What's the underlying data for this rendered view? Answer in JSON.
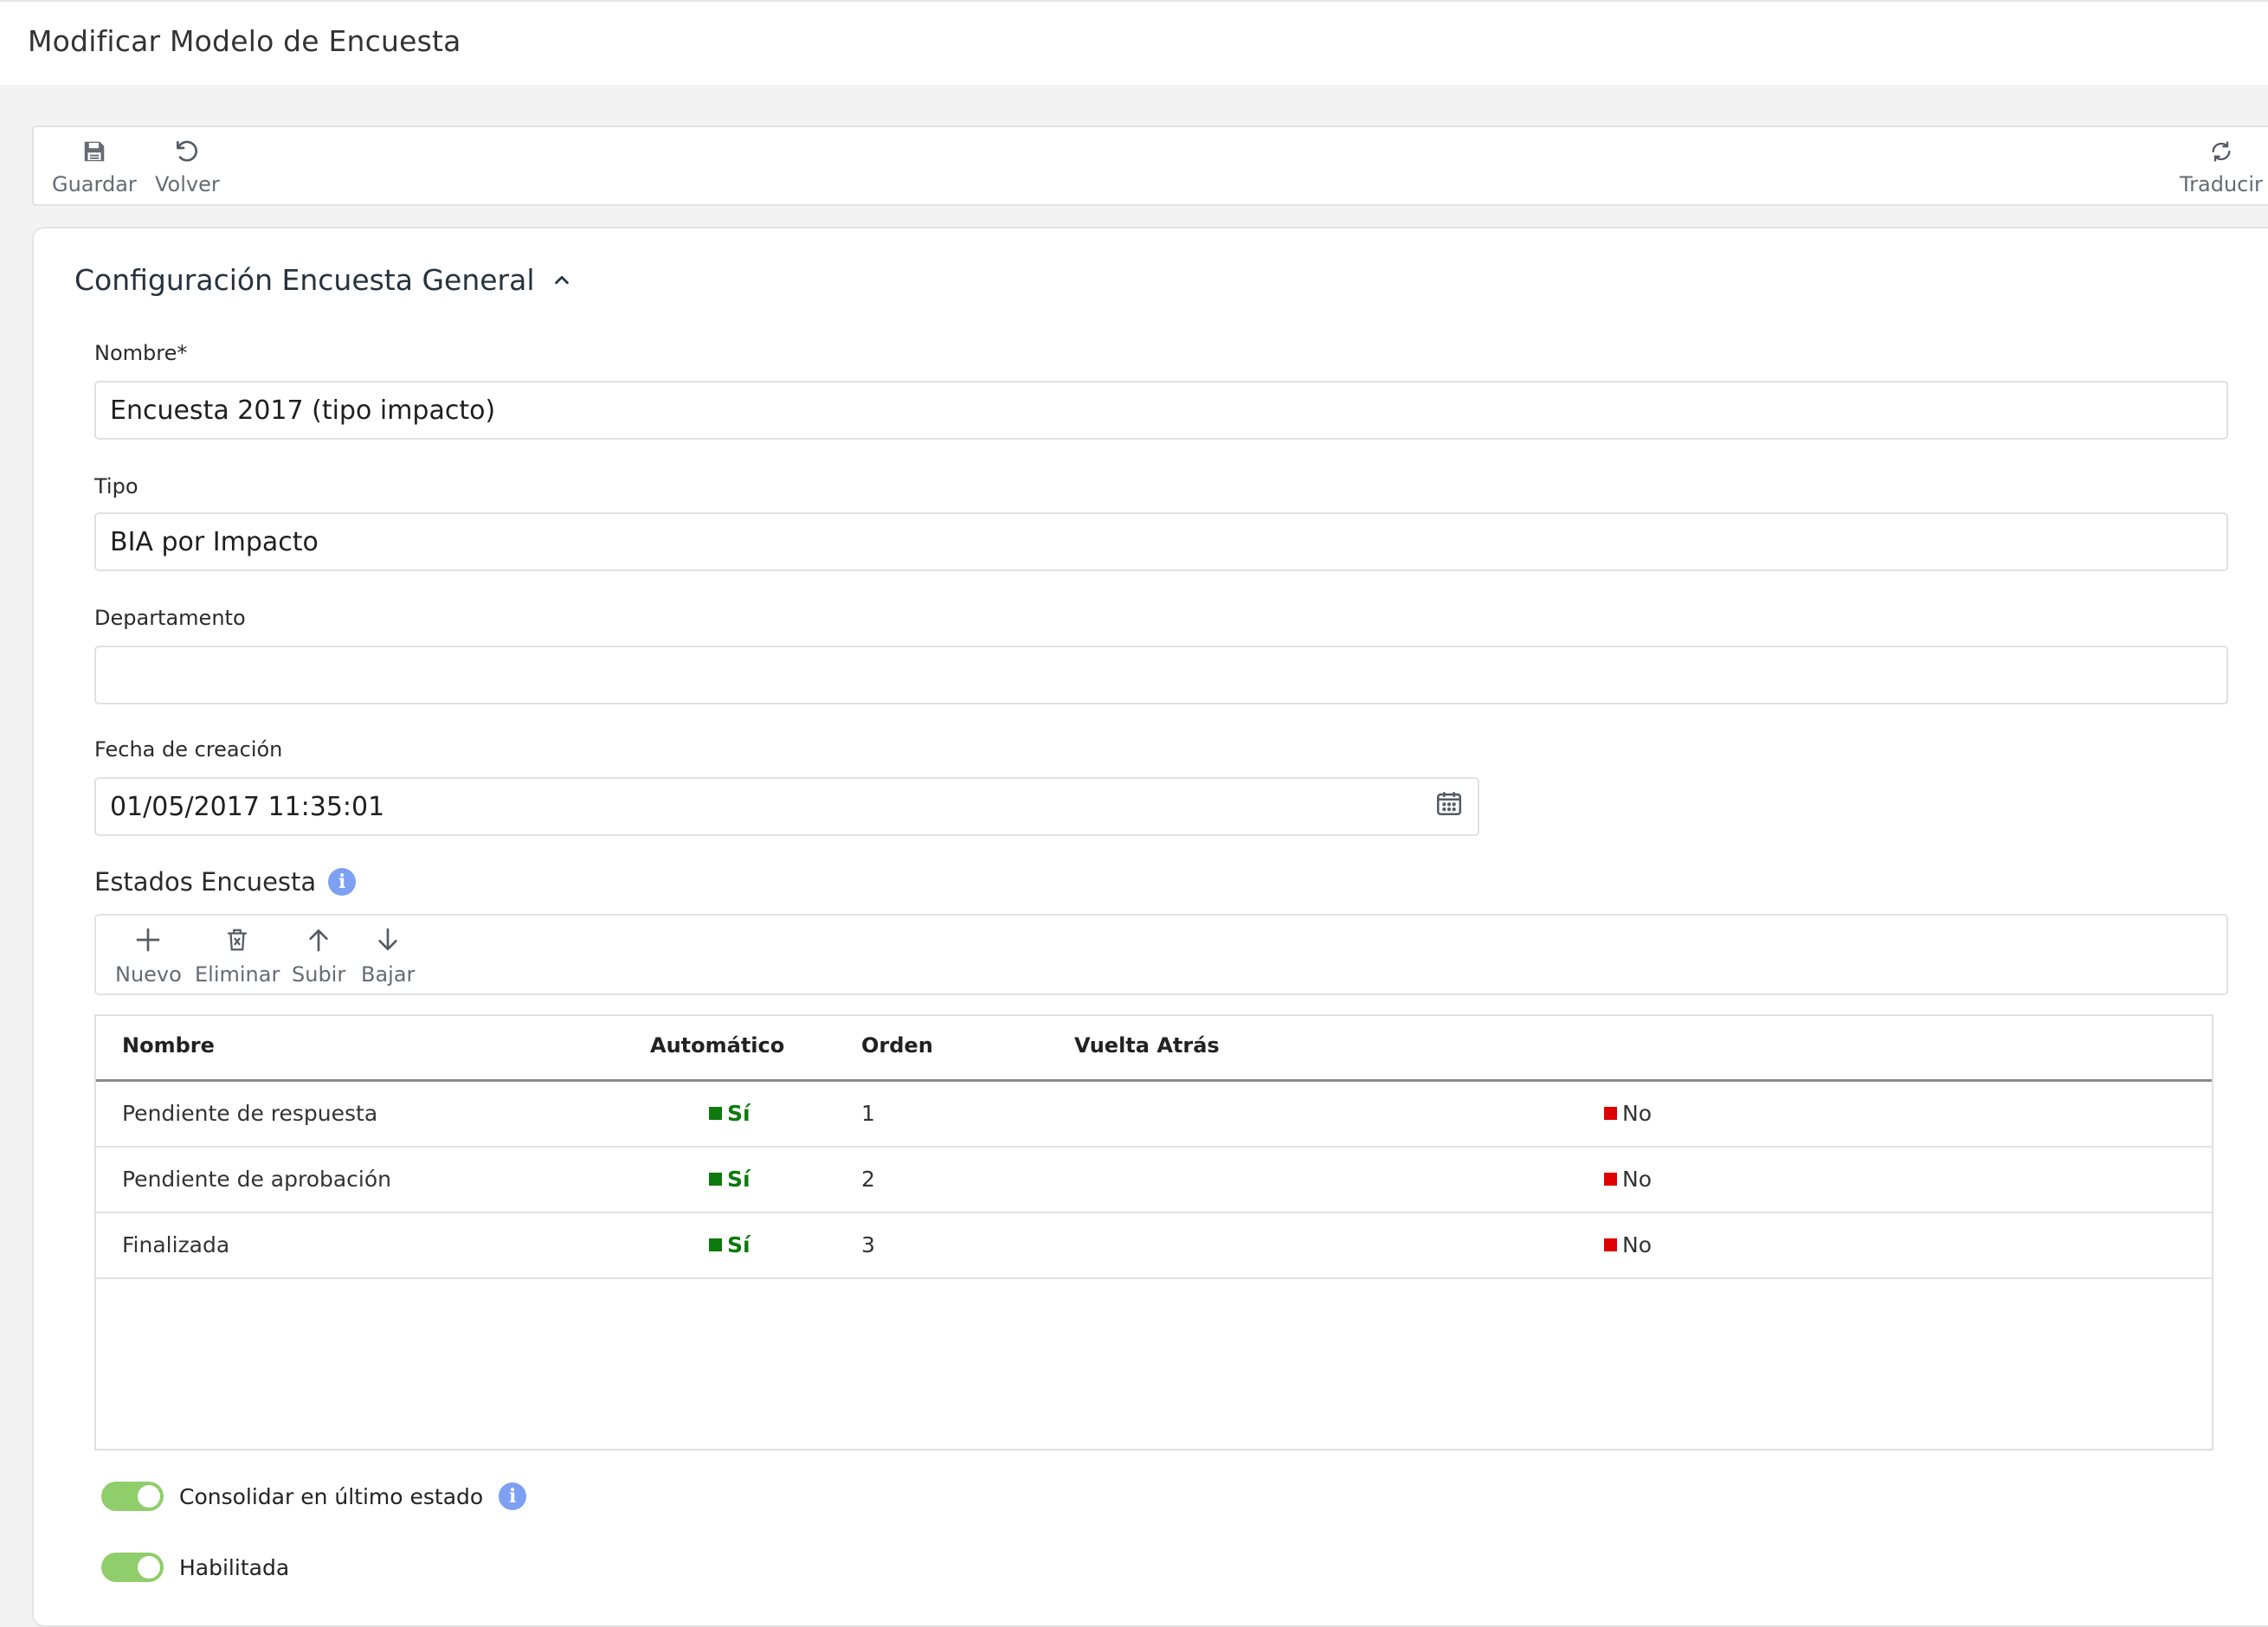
{
  "page": {
    "title": "Modificar Modelo de Encuesta"
  },
  "toolbar": {
    "save_label": "Guardar",
    "back_label": "Volver",
    "translate_label": "Traducir"
  },
  "section": {
    "title": "Configuración Encuesta General"
  },
  "form": {
    "nombre": {
      "label": "Nombre*",
      "value": "Encuesta 2017 (tipo impacto)"
    },
    "tipo": {
      "label": "Tipo",
      "value": "BIA por Impacto"
    },
    "departamento": {
      "label": "Departamento",
      "value": ""
    },
    "fecha": {
      "label": "Fecha de creación",
      "value": "01/05/2017 11:35:01"
    }
  },
  "estados": {
    "title": "Estados Encuesta",
    "toolbar": {
      "new": "Nuevo",
      "delete": "Eliminar",
      "up": "Subir",
      "down": "Bajar"
    },
    "columns": {
      "nombre": "Nombre",
      "automatico": "Automático",
      "orden": "Orden",
      "vuelta": "Vuelta Atrás"
    },
    "rows": [
      {
        "nombre": "Pendiente de respuesta",
        "automatico": "Sí",
        "orden": "1",
        "vuelta": "No"
      },
      {
        "nombre": "Pendiente de aprobación",
        "automatico": "Sí",
        "orden": "2",
        "vuelta": "No"
      },
      {
        "nombre": "Finalizada",
        "automatico": "Sí",
        "orden": "3",
        "vuelta": "No"
      }
    ]
  },
  "toggles": {
    "consolidar": {
      "label": "Consolidar en último estado",
      "on": true
    },
    "habilitada": {
      "label": "Habilitada",
      "on": true
    }
  },
  "colors": {
    "yes": "#0e7a0e",
    "no": "#e00000",
    "toggle_on": "#8fce6a",
    "info": "#7da0f2"
  }
}
